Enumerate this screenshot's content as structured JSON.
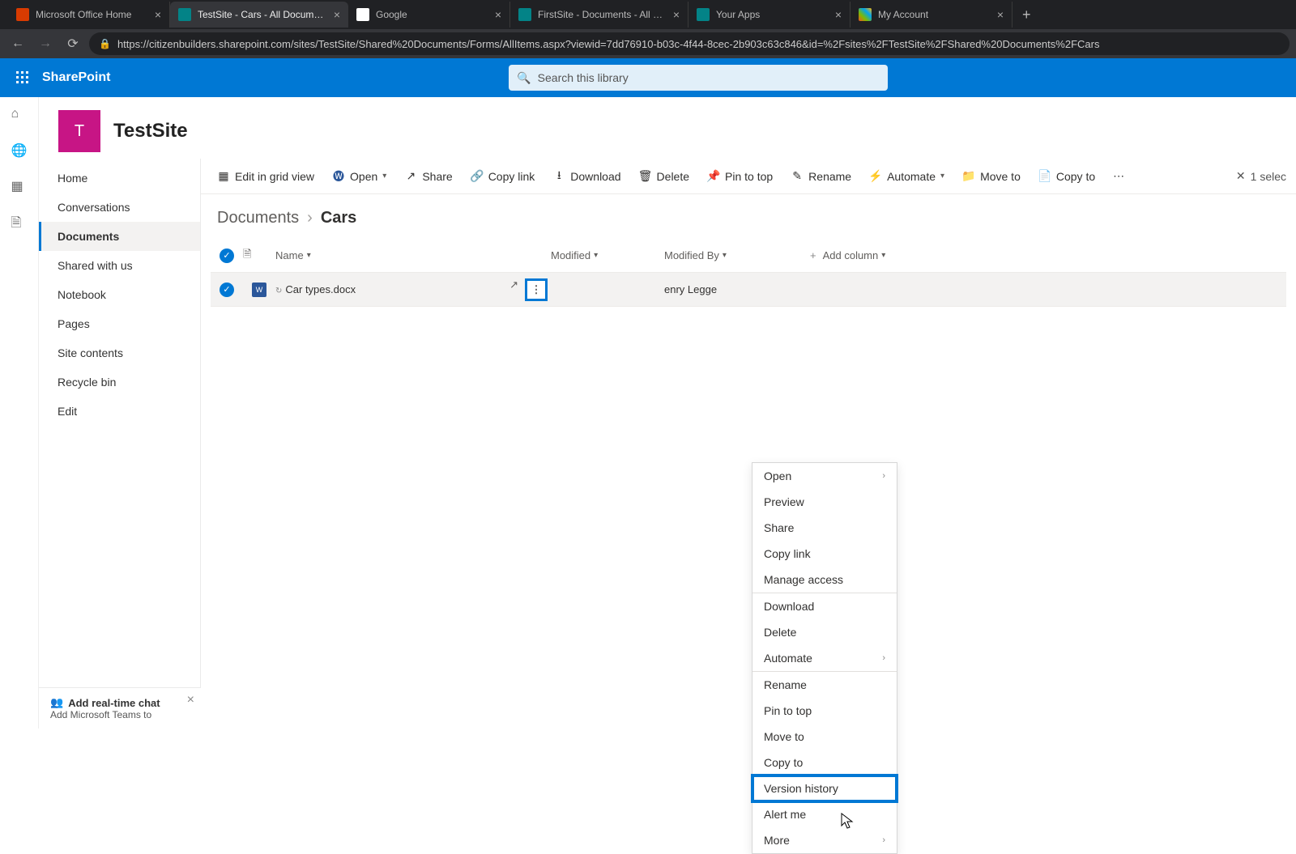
{
  "browser": {
    "tabs": [
      {
        "title": "Microsoft Office Home",
        "iconColor": "#d83b01"
      },
      {
        "title": "TestSite - Cars - All Documents",
        "iconColor": "#038387",
        "active": true
      },
      {
        "title": "Google",
        "iconColor": "#ffffff"
      },
      {
        "title": "FirstSite - Documents - All Docum",
        "iconColor": "#038387"
      },
      {
        "title": "Your Apps",
        "iconColor": "#038387"
      },
      {
        "title": "My Account",
        "iconColor": "#00a4ef"
      }
    ],
    "url": "https://citizenbuilders.sharepoint.com/sites/TestSite/Shared%20Documents/Forms/AllItems.aspx?viewid=7dd76910-b03c-4f44-8cec-2b903c63c846&id=%2Fsites%2FTestSite%2FShared%20Documents%2FCars"
  },
  "header": {
    "brand": "SharePoint",
    "searchPlaceholder": "Search this library"
  },
  "site": {
    "logoLetter": "T",
    "title": "TestSite"
  },
  "nav": {
    "items": [
      "Home",
      "Conversations",
      "Documents",
      "Shared with us",
      "Notebook",
      "Pages",
      "Site contents",
      "Recycle bin",
      "Edit"
    ],
    "activeIndex": 2
  },
  "commandBar": {
    "editGrid": "Edit in grid view",
    "open": "Open",
    "share": "Share",
    "copyLink": "Copy link",
    "download": "Download",
    "delete": "Delete",
    "pinToTop": "Pin to top",
    "rename": "Rename",
    "automate": "Automate",
    "moveTo": "Move to",
    "copyTo": "Copy to",
    "selected": "1 selec"
  },
  "breadcrumb": {
    "root": "Documents",
    "current": "Cars"
  },
  "columns": {
    "name": "Name",
    "modified": "Modified",
    "modifiedBy": "Modified By",
    "addColumn": "Add column"
  },
  "row": {
    "fileName": "Car types.docx",
    "modifiedBy": "enry Legge"
  },
  "contextMenu": {
    "open": "Open",
    "preview": "Preview",
    "share": "Share",
    "copyLink": "Copy link",
    "manageAccess": "Manage access",
    "download": "Download",
    "delete": "Delete",
    "automate": "Automate",
    "rename": "Rename",
    "pinToTop": "Pin to top",
    "moveTo": "Move to",
    "copyTo": "Copy to",
    "versionHistory": "Version history",
    "alertMe": "Alert me",
    "more": "More"
  },
  "promo": {
    "title": "Add real-time chat",
    "subtitle": "Add Microsoft Teams to"
  }
}
